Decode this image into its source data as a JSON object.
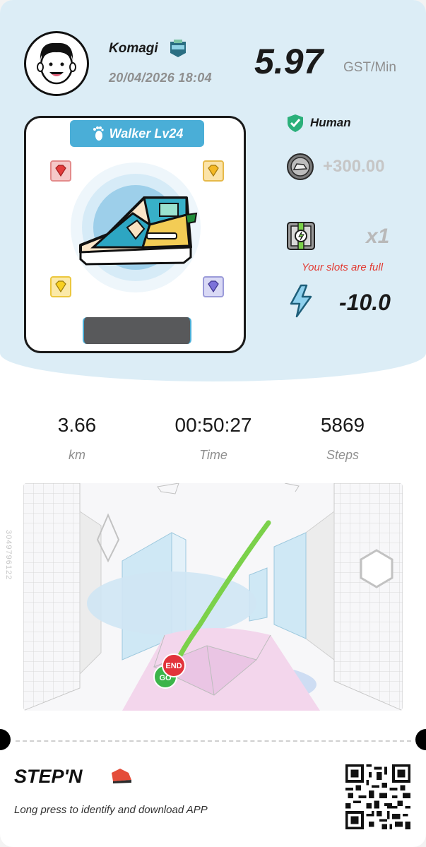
{
  "user": {
    "name": "Komagi",
    "datetime": "20/04/2026 18:04"
  },
  "earnings": {
    "rate": "5.97",
    "unit": "GST/Min"
  },
  "shoe": {
    "type_level": "Walker Lv24"
  },
  "status": {
    "human_label": "Human",
    "gst_bonus": "+300.00",
    "mystery_box_count": "x1",
    "slots_message": "Your slots are full",
    "energy": "-10.0"
  },
  "stats": [
    {
      "value": "3.66",
      "label": "km"
    },
    {
      "value": "00:50:27",
      "label": "Time"
    },
    {
      "value": "5869",
      "label": "Steps"
    }
  ],
  "map": {
    "side_id": "3049796122",
    "end_marker": "END",
    "start_marker": "GO"
  },
  "footer": {
    "brand": "STEP'N",
    "prompt": "Long press to identify and download APP"
  },
  "colors": {
    "header_bg": "#dcedf6",
    "accent_blue": "#4aaed7",
    "route_green": "#7bd14a",
    "warning_red": "#e23b33",
    "end_red": "#e2333b",
    "go_green": "#3cb44a"
  },
  "icons": [
    "avatar",
    "badge-icon",
    "footprint-icon",
    "ruby-gem-icon",
    "topaz-gem-icon",
    "citrine-gem-icon",
    "amethyst-gem-icon",
    "shield-check-icon",
    "gst-coin-icon",
    "mystery-box-icon",
    "lightning-icon",
    "qr-code"
  ]
}
